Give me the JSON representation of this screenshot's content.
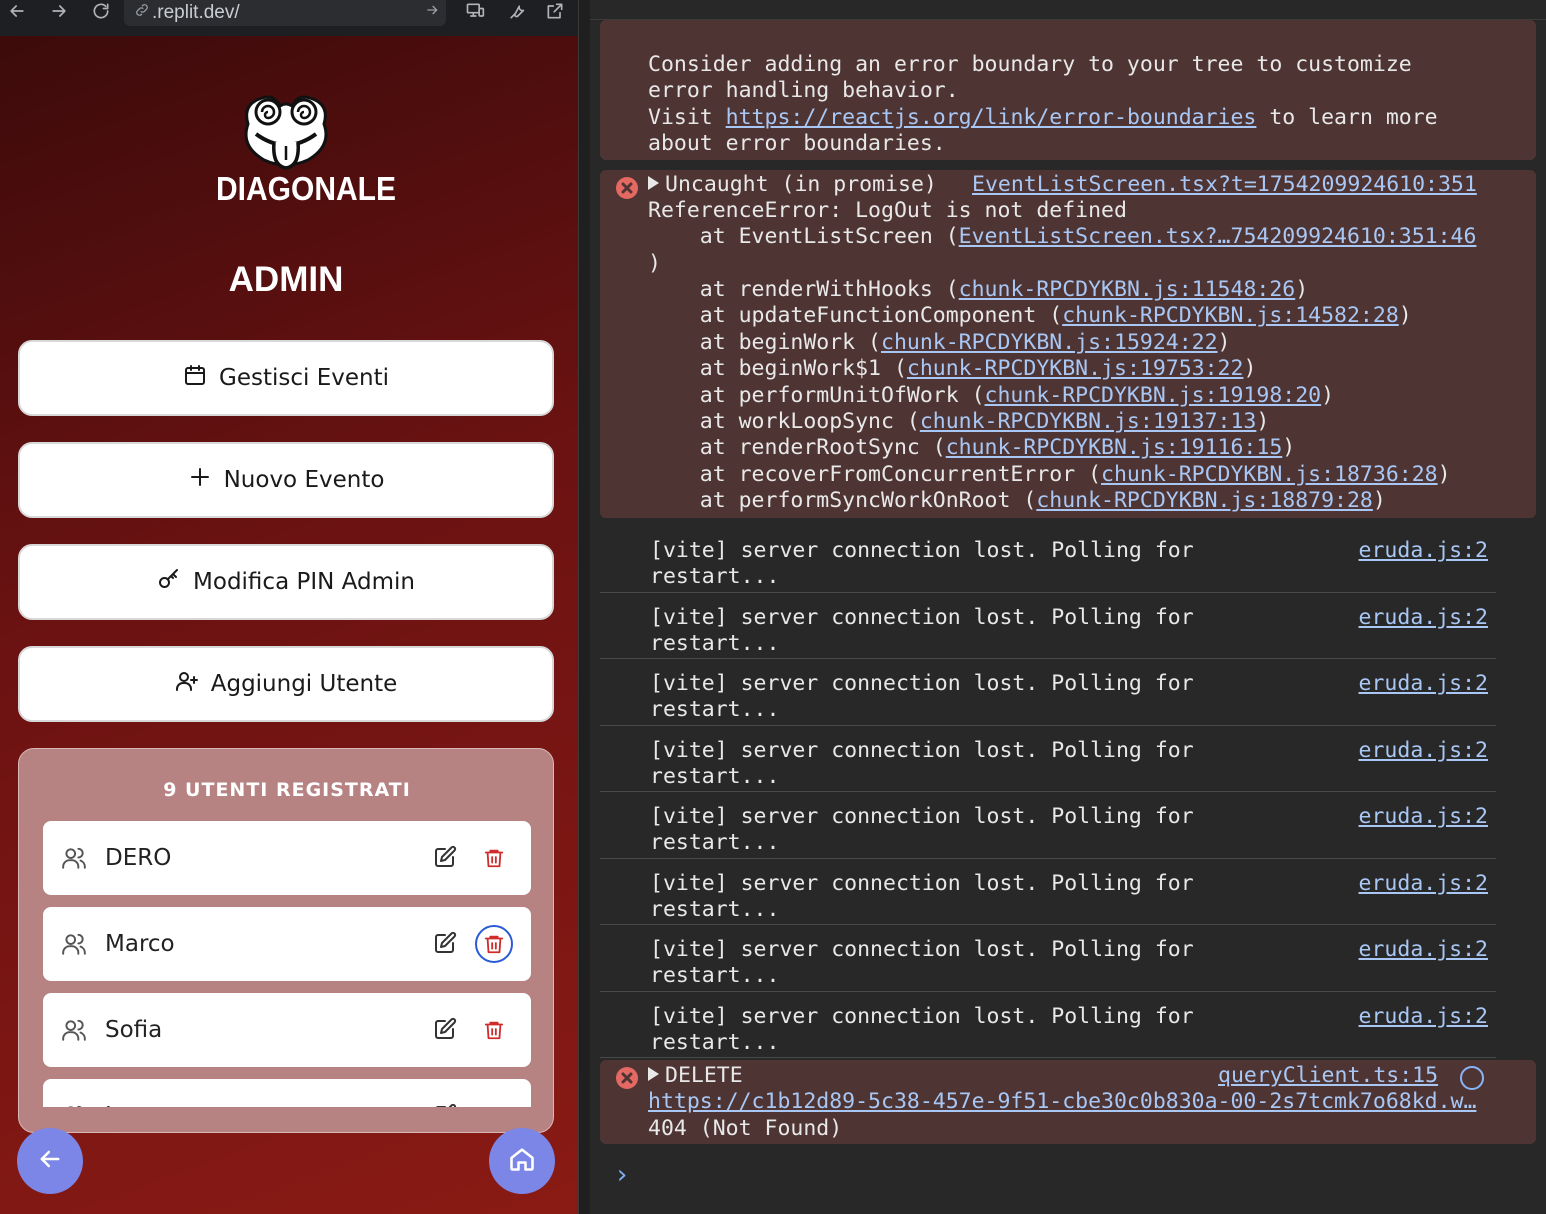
{
  "browser": {
    "url": ".replit.dev/"
  },
  "app": {
    "logo_text": "DIAGONALE",
    "title": "ADMIN",
    "menu": [
      {
        "label": "Gestisci Eventi",
        "icon": "calendar-icon"
      },
      {
        "label": "Nuovo Evento",
        "icon": "plus-icon"
      },
      {
        "label": "Modifica PIN Admin",
        "icon": "key-icon"
      },
      {
        "label": "Aggiungi Utente",
        "icon": "user-plus-icon"
      }
    ],
    "users_title": "9 UTENTI REGISTRATI",
    "users": [
      "DERO",
      "Marco",
      "Sofia",
      "L"
    ],
    "colors": {
      "accent": "#7b86e6",
      "danger": "#d12c2c",
      "bg": "#6b1212",
      "panel": "#b68382"
    }
  },
  "console": {
    "boundary_msg": [
      "Consider adding an error boundary to your tree to customize",
      "error handling behavior.",
      "Visit ",
      "https://reactjs.org/link/error-boundaries",
      " to learn more",
      "about error boundaries."
    ],
    "uncaught": {
      "head": "Uncaught (in promise) ",
      "src": "EventListScreen.tsx?t=1754209924610:351",
      "error": "ReferenceError: LogOut is not defined",
      "stack_first_prefix": "    at EventListScreen (",
      "stack_first_link": "EventListScreen.tsx?…754209924610:351:46",
      "stack_first_close": ")",
      "stack": [
        {
          "fn": "    at renderWithHooks (",
          "link": "chunk-RPCDYKBN.js:11548:26"
        },
        {
          "fn": "    at updateFunctionComponent (",
          "link": "chunk-RPCDYKBN.js:14582:28"
        },
        {
          "fn": "    at beginWork (",
          "link": "chunk-RPCDYKBN.js:15924:22"
        },
        {
          "fn": "    at beginWork$1 (",
          "link": "chunk-RPCDYKBN.js:19753:22"
        },
        {
          "fn": "    at performUnitOfWork (",
          "link": "chunk-RPCDYKBN.js:19198:20"
        },
        {
          "fn": "    at workLoopSync (",
          "link": "chunk-RPCDYKBN.js:19137:13"
        },
        {
          "fn": "    at renderRootSync (",
          "link": "chunk-RPCDYKBN.js:19116:15"
        },
        {
          "fn": "    at recoverFromConcurrentError (",
          "link": "chunk-RPCDYKBN.js:18736:28"
        },
        {
          "fn": "    at performSyncWorkOnRoot (",
          "link": "chunk-RPCDYKBN.js:18879:28"
        }
      ]
    },
    "vite_line1": "[vite] server connection lost. Polling for",
    "vite_line2": "restart...",
    "vite_src": "eruda.js:2",
    "vite_count": 8,
    "delete": {
      "head": "DELETE",
      "src": "queryClient.ts:15",
      "url": "https://c1b12d89-5c38-457e-9f51-cbe30c0b830a-00-2s7tcmk7o68kd.w…",
      "status": "404 (Not Found)"
    },
    "prompt": "›"
  }
}
